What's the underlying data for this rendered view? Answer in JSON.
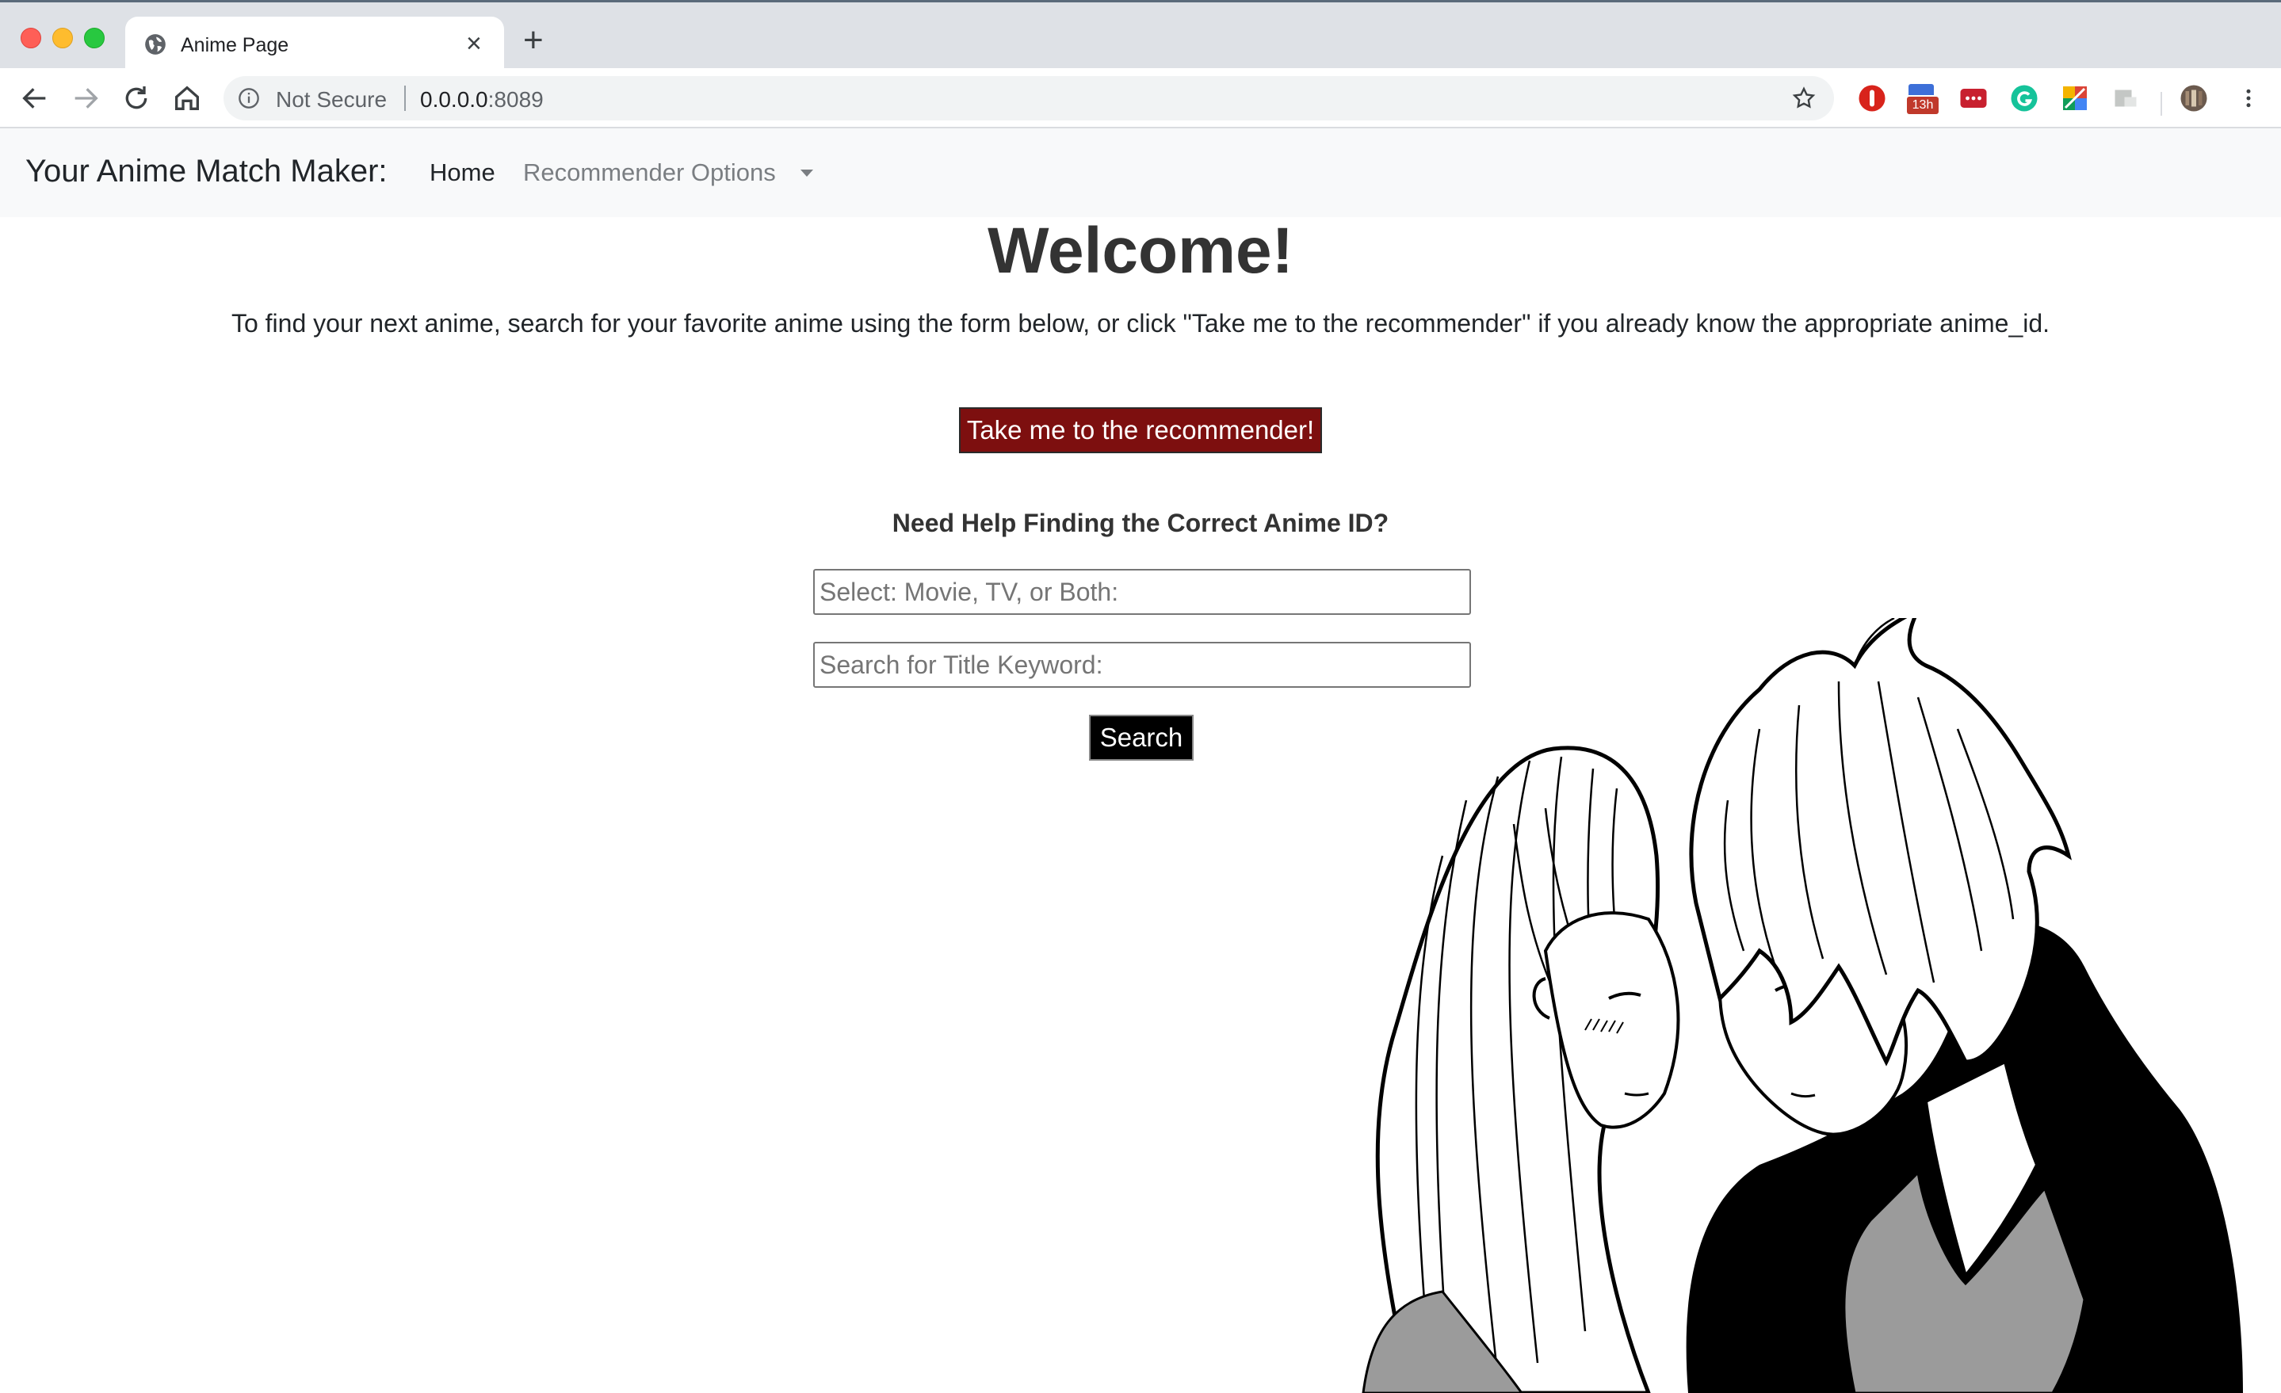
{
  "browser": {
    "tab_title": "Anime Page",
    "tab_close": "×",
    "new_tab": "+",
    "security_label": "Not Secure",
    "url_host": "0.0.0.0",
    "url_port": ":8089",
    "extension_badge": "13h"
  },
  "navbar": {
    "brand": "Your Anime Match Maker:",
    "items": [
      {
        "label": "Home"
      },
      {
        "label": "Recommender Options"
      }
    ]
  },
  "main": {
    "heading": "Welcome!",
    "intro": "To find your next anime, search for your favorite anime using the form below, or click \"Take me to the recommender\" if you already know the appropriate anime_id.",
    "recommender_button": "Take me to the recommender!",
    "help_heading": "Need Help Finding the Correct Anime ID?",
    "type_placeholder": "Select: Movie, TV, or Both:",
    "keyword_placeholder": "Search for Title Keyword:",
    "search_button": "Search"
  },
  "colors": {
    "recommender_button": "#7d0f0f",
    "search_button": "#000000",
    "navbar_bg": "#f8f9fa"
  }
}
